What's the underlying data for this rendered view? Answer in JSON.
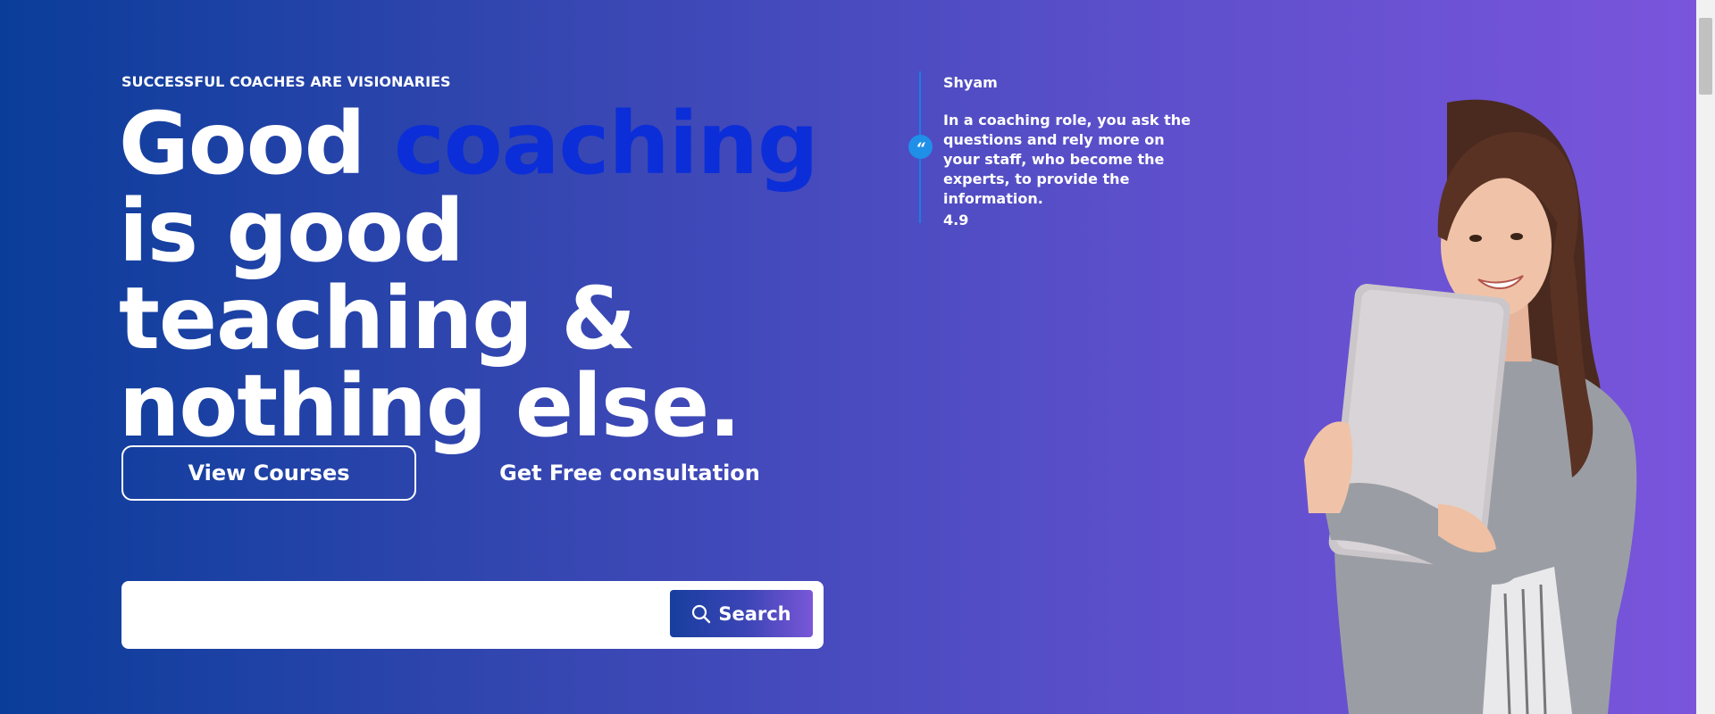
{
  "hero": {
    "eyebrow": "SUCCESSFUL COACHES ARE VISIONARIES",
    "headline_part1": "Good ",
    "headline_accent": "coaching",
    "headline_part2": " is good teaching & nothing else.",
    "accent_color": "#0b2ed8"
  },
  "actions": {
    "view_courses": "View Courses",
    "consultation": "Get Free consultation"
  },
  "search": {
    "placeholder": "",
    "button_label": "Search",
    "icon": "search-icon"
  },
  "testimonial": {
    "name": "Shyam",
    "quote_icon": "quote-icon",
    "quote_glyph": "“",
    "text": "In a coaching role, you ask the questions and rely more on your staff, who become the experts, to provide the information.",
    "rating": "4.9"
  },
  "colors": {
    "gradient_start": "#0a3d9a",
    "gradient_end": "#7b55dd",
    "quote_badge": "#1f8fe8"
  }
}
